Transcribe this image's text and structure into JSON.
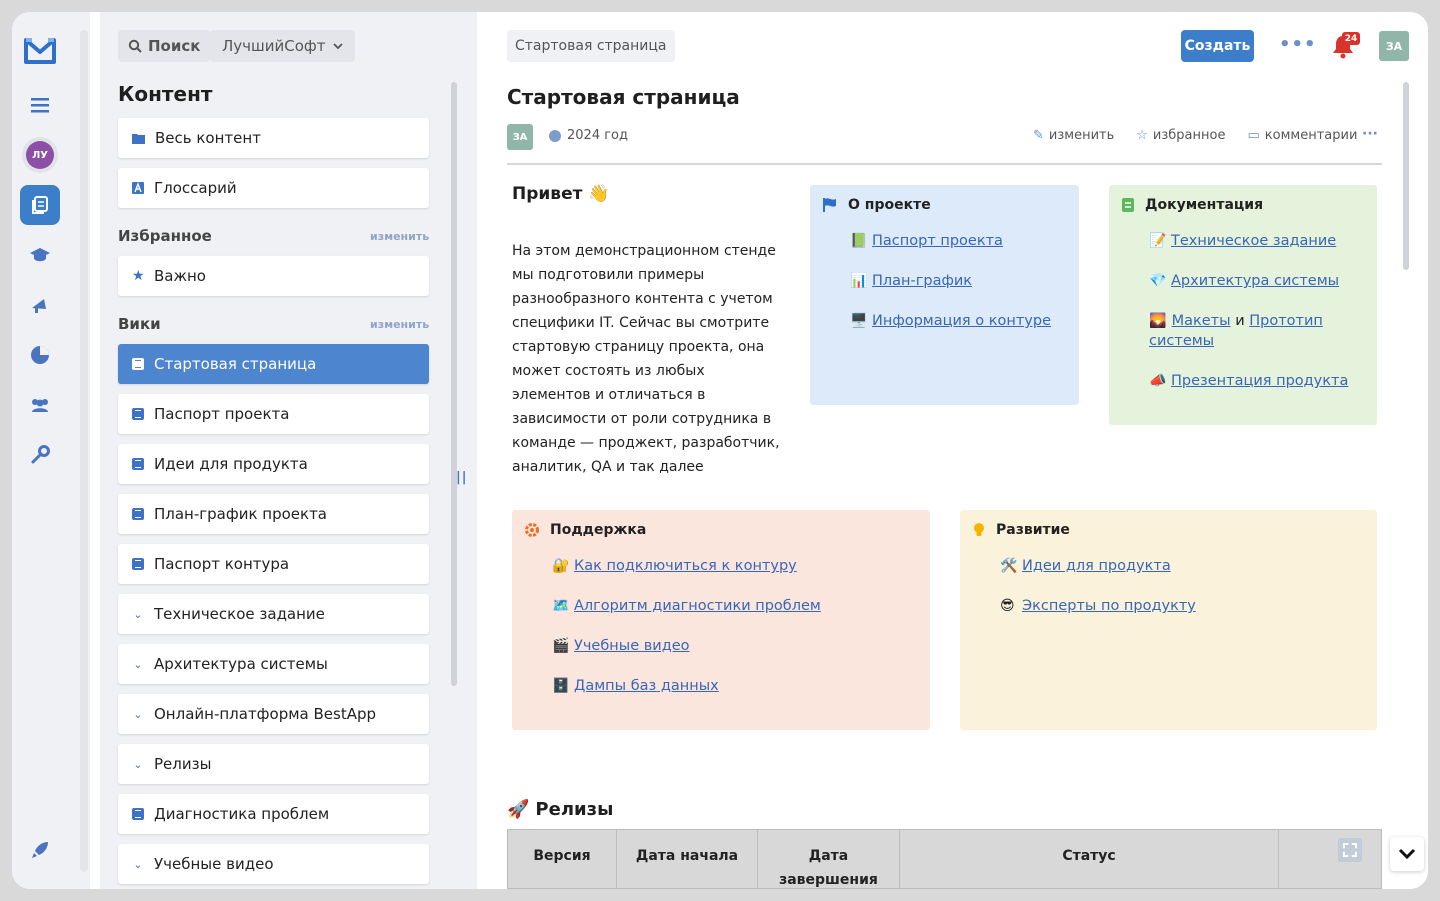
{
  "rail": {
    "logo": "m-logo-icon",
    "avatar": "ЛУ",
    "items": [
      "menu-icon",
      "content-icon",
      "education-icon",
      "broadcast-icon",
      "reports-icon",
      "team-icon",
      "settings-icon"
    ],
    "bottom": "rocket-icon"
  },
  "sidebar": {
    "search_label": "Поиск",
    "org_label": "ЛучшийСофт",
    "section_title": "Контент",
    "content_items": [
      {
        "label": "Весь контент"
      },
      {
        "label": "Глоссарий"
      }
    ],
    "favorites": {
      "title": "Избранное",
      "edit": "изменить",
      "items": [
        {
          "label": "Важно"
        }
      ]
    },
    "wiki": {
      "title": "Вики",
      "edit": "изменить",
      "items": [
        {
          "label": "Стартовая страница",
          "active": true
        },
        {
          "label": "Паспорт проекта"
        },
        {
          "label": "Идеи для продукта"
        },
        {
          "label": "План-график проекта"
        },
        {
          "label": "Паспорт контура"
        },
        {
          "label": "Техническое задание"
        },
        {
          "label": "Архитектура системы"
        },
        {
          "label": "Онлайн-платформа BestApp"
        },
        {
          "label": "Релизы"
        },
        {
          "label": "Диагностика проблем"
        },
        {
          "label": "Учебные видео"
        }
      ]
    }
  },
  "header": {
    "breadcrumb": "Стартовая страница",
    "create_button": "Создать",
    "notifications_count": "24",
    "user_initials": "ЗА"
  },
  "page": {
    "title": "Стартовая страница",
    "author_initials": "ЗА",
    "year": "2024 год",
    "actions": {
      "edit": "изменить",
      "favorite": "избранное",
      "comments": "комментарии"
    },
    "hello": {
      "title": "Привет 👋",
      "text": "На этом демонстрационном стенде мы подготовили примеры разнообразного контента с учетом специфики IT. Сейчас вы смотрите стартовую страницу проекта, она может состоять из любых элементов и отличаться в зависимости от роли сотрудника в команде — проджект, разработчик, аналитик, QA и так далее"
    },
    "about": {
      "title": "О проекте",
      "links": [
        {
          "emoji": "📗",
          "text": "Паспорт проекта"
        },
        {
          "emoji": "📊",
          "text": "План-график"
        },
        {
          "emoji": "🖥️",
          "text": "Информация о контуре"
        }
      ]
    },
    "docs": {
      "title": "Документация",
      "links": [
        {
          "emoji": "📝",
          "text": "Техническое задание"
        },
        {
          "emoji": "💎",
          "text": "Архитектура системы"
        }
      ],
      "combo": {
        "emoji": "🌄",
        "first": "Макеты",
        "joiner": "и",
        "second": "Прототип системы"
      },
      "last": {
        "emoji": "📣",
        "text": "Презентация продукта"
      }
    },
    "support": {
      "title": "Поддержка",
      "links": [
        {
          "emoji": "🔐",
          "text": "Как подключиться к контуру"
        },
        {
          "emoji": "🗺️",
          "text": "Алгоритм диагностики проблем"
        },
        {
          "emoji": "🎬",
          "text": "Учебные видео"
        },
        {
          "emoji": "🗄️",
          "text": "Дампы баз данных"
        }
      ]
    },
    "development": {
      "title": "Развитие",
      "links": [
        {
          "emoji": "🛠️",
          "text": "Идеи для продукта"
        },
        {
          "emoji": "😎",
          "text": "Эксперты по продукту"
        }
      ]
    },
    "releases": {
      "title": "Релизы",
      "emoji": "🚀",
      "columns": [
        "Версия",
        "Дата начала",
        "Дата завершения",
        "Статус"
      ]
    }
  },
  "colors": {
    "accent": "#3c7ec9",
    "about_bg": "#ddeaf9",
    "docs_bg": "#e5f3dc",
    "support_bg": "#fbe6de",
    "development_bg": "#fbf2dc"
  }
}
